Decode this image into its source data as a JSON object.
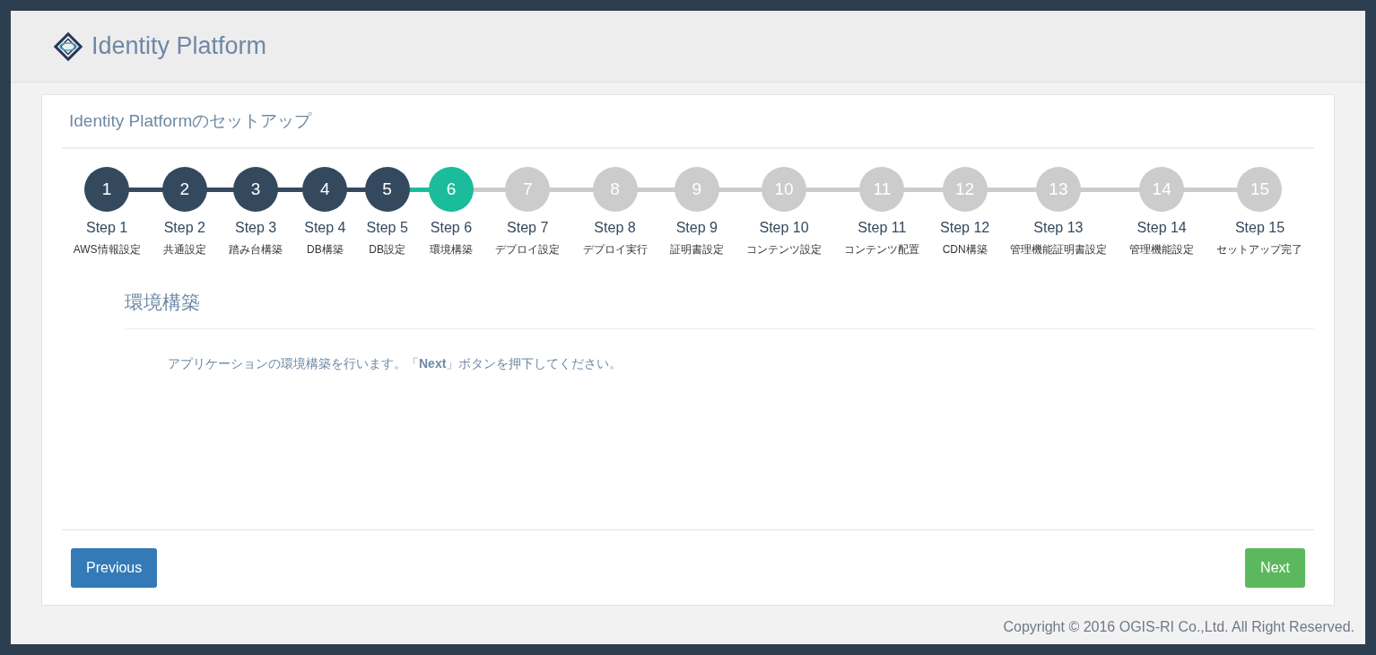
{
  "header": {
    "brand": "Identity Platform"
  },
  "card": {
    "title": "Identity Platformのセットアップ"
  },
  "steps": [
    {
      "number": "1",
      "label": "Step 1",
      "caption": "AWS情報設定",
      "completed": true,
      "selected": false
    },
    {
      "number": "2",
      "label": "Step 2",
      "caption": "共通設定",
      "completed": true,
      "selected": false
    },
    {
      "number": "3",
      "label": "Step 3",
      "caption": "踏み台構築",
      "completed": true,
      "selected": false
    },
    {
      "number": "4",
      "label": "Step 4",
      "caption": "DB構築",
      "completed": true,
      "selected": false
    },
    {
      "number": "5",
      "label": "Step 5",
      "caption": "DB設定",
      "completed": true,
      "selected": false
    },
    {
      "number": "6",
      "label": "Step 6",
      "caption": "環境構築",
      "completed": false,
      "selected": true
    },
    {
      "number": "7",
      "label": "Step 7",
      "caption": "デプロイ設定",
      "completed": false,
      "selected": false
    },
    {
      "number": "8",
      "label": "Step 8",
      "caption": "デプロイ実行",
      "completed": false,
      "selected": false
    },
    {
      "number": "9",
      "label": "Step 9",
      "caption": "証明書設定",
      "completed": false,
      "selected": false
    },
    {
      "number": "10",
      "label": "Step 10",
      "caption": "コンテンツ設定",
      "completed": false,
      "selected": false
    },
    {
      "number": "11",
      "label": "Step 11",
      "caption": "コンテンツ配置",
      "completed": false,
      "selected": false
    },
    {
      "number": "12",
      "label": "Step 12",
      "caption": "CDN構築",
      "completed": false,
      "selected": false
    },
    {
      "number": "13",
      "label": "Step 13",
      "caption": "管理機能証明書設定",
      "completed": false,
      "selected": false
    },
    {
      "number": "14",
      "label": "Step 14",
      "caption": "管理機能設定",
      "completed": false,
      "selected": false
    },
    {
      "number": "15",
      "label": "Step 15",
      "caption": "セットアップ完了",
      "completed": false,
      "selected": false
    }
  ],
  "section": {
    "title": "環境構築",
    "description": "アプリケーションの環境構築を行います。「**Next**」ボタンを押下してください。"
  },
  "buttons": {
    "previous": "Previous",
    "next": "Next"
  },
  "footer": {
    "copyright": "Copyright © 2016 OGIS-RI Co.,Ltd. All Right Reserved."
  }
}
